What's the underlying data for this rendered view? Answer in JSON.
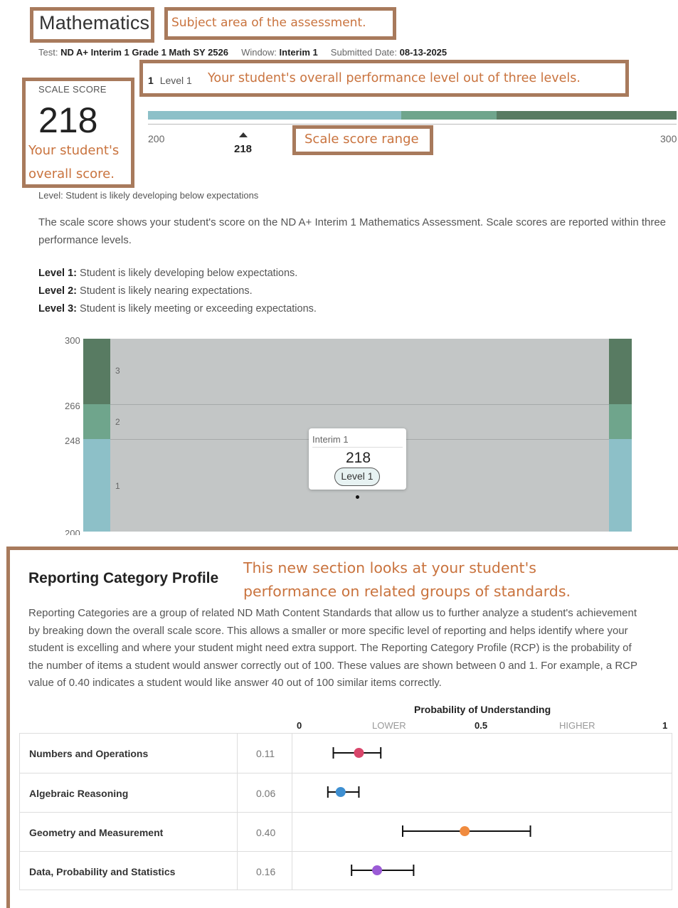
{
  "header": {
    "subject": "Mathematics",
    "test_label": "Test:",
    "test_value": "ND A+ Interim 1 Grade 1 Math SY 2526",
    "window_label": "Window:",
    "window_value": "Interim 1",
    "submitted_label": "Submitted Date:",
    "submitted_value": "08-13-2025"
  },
  "callouts": {
    "subject": "Subject area of the assessment.",
    "level": "Your student's overall performance level out of three levels.",
    "score_line1": "Your student's",
    "score_line2": "overall score.",
    "range": "Scale score range",
    "rcp_line1": "This new section looks at your student's",
    "rcp_line2": "performance on related groups of standards."
  },
  "score": {
    "label": "SCALE SCORE",
    "value": "218",
    "level_number": "1",
    "level_name": "Level 1",
    "range_min": "200",
    "range_max": "300",
    "marker_value": "218",
    "level_desc": "Level: Student is likely developing below expectations"
  },
  "colors": {
    "level1": "#8dc0c8",
    "level2": "#6fa58c",
    "level3": "#587b62",
    "chart_bg": "#c3c6c6",
    "callout_border": "#a87a5c",
    "callout_text": "#c9733e",
    "ops_dot": "#d9466b",
    "alg_dot": "#3e8fd1",
    "geo_dot": "#f08b3f",
    "data_dot": "#9b5bd6"
  },
  "explanation": {
    "paragraph": "The scale score shows your student's score on the ND A+ Interim 1 Mathematics Assessment. Scale scores are reported within three performance levels.",
    "levels": [
      {
        "label": "Level 1:",
        "text": "Student is likely developing below expectations."
      },
      {
        "label": "Level 2:",
        "text": "Student is likely nearing expectations."
      },
      {
        "label": "Level 3:",
        "text": "Student is likely meeting or exceeding expectations."
      }
    ]
  },
  "history_chart": {
    "y_ticks": [
      "300",
      "266",
      "248",
      "200"
    ],
    "band_labels": [
      "3",
      "2",
      "1"
    ],
    "tooltip_title": "Interim 1",
    "tooltip_score": "218",
    "tooltip_level": "Level 1"
  },
  "rcp": {
    "title": "Reporting Category Profile",
    "paragraph_lines": [
      "Reporting Categories are a group of related ND Math Content Standards that allow us to further analyze a student's achievement",
      "by breaking down the overall scale score. This allows a smaller or more specific level of reporting and helps identify where your",
      "student is excelling and where your student might need extra support. The Reporting Category Profile (RCP) is the probability of",
      "the number of items a student would answer correctly out of 100. These values are shown between 0 and 1. For example, a RCP",
      "value of 0.40 indicates a student would like answer 40 out of 100 similar items correctly."
    ],
    "axis_title": "Probability of Understanding",
    "axis_labels": {
      "zero": "0",
      "lower": "LOWER",
      "half": "0.5",
      "higher": "HIGHER",
      "one": "1"
    }
  },
  "chart_data": {
    "type": "scatter",
    "title": "Probability of Understanding",
    "xlim": [
      0,
      1
    ],
    "categories": [
      "Numbers and Operations",
      "Algebraic Reasoning",
      "Geometry and Measurement",
      "Data, Probability and Statistics"
    ],
    "values": [
      0.11,
      0.06,
      0.4,
      0.16
    ],
    "value_labels": [
      "0.11",
      "0.06",
      "0.40",
      "0.16"
    ],
    "error_low": [
      0.04,
      0.025,
      0.23,
      0.09
    ],
    "error_high": [
      0.17,
      0.11,
      0.58,
      0.26
    ]
  }
}
